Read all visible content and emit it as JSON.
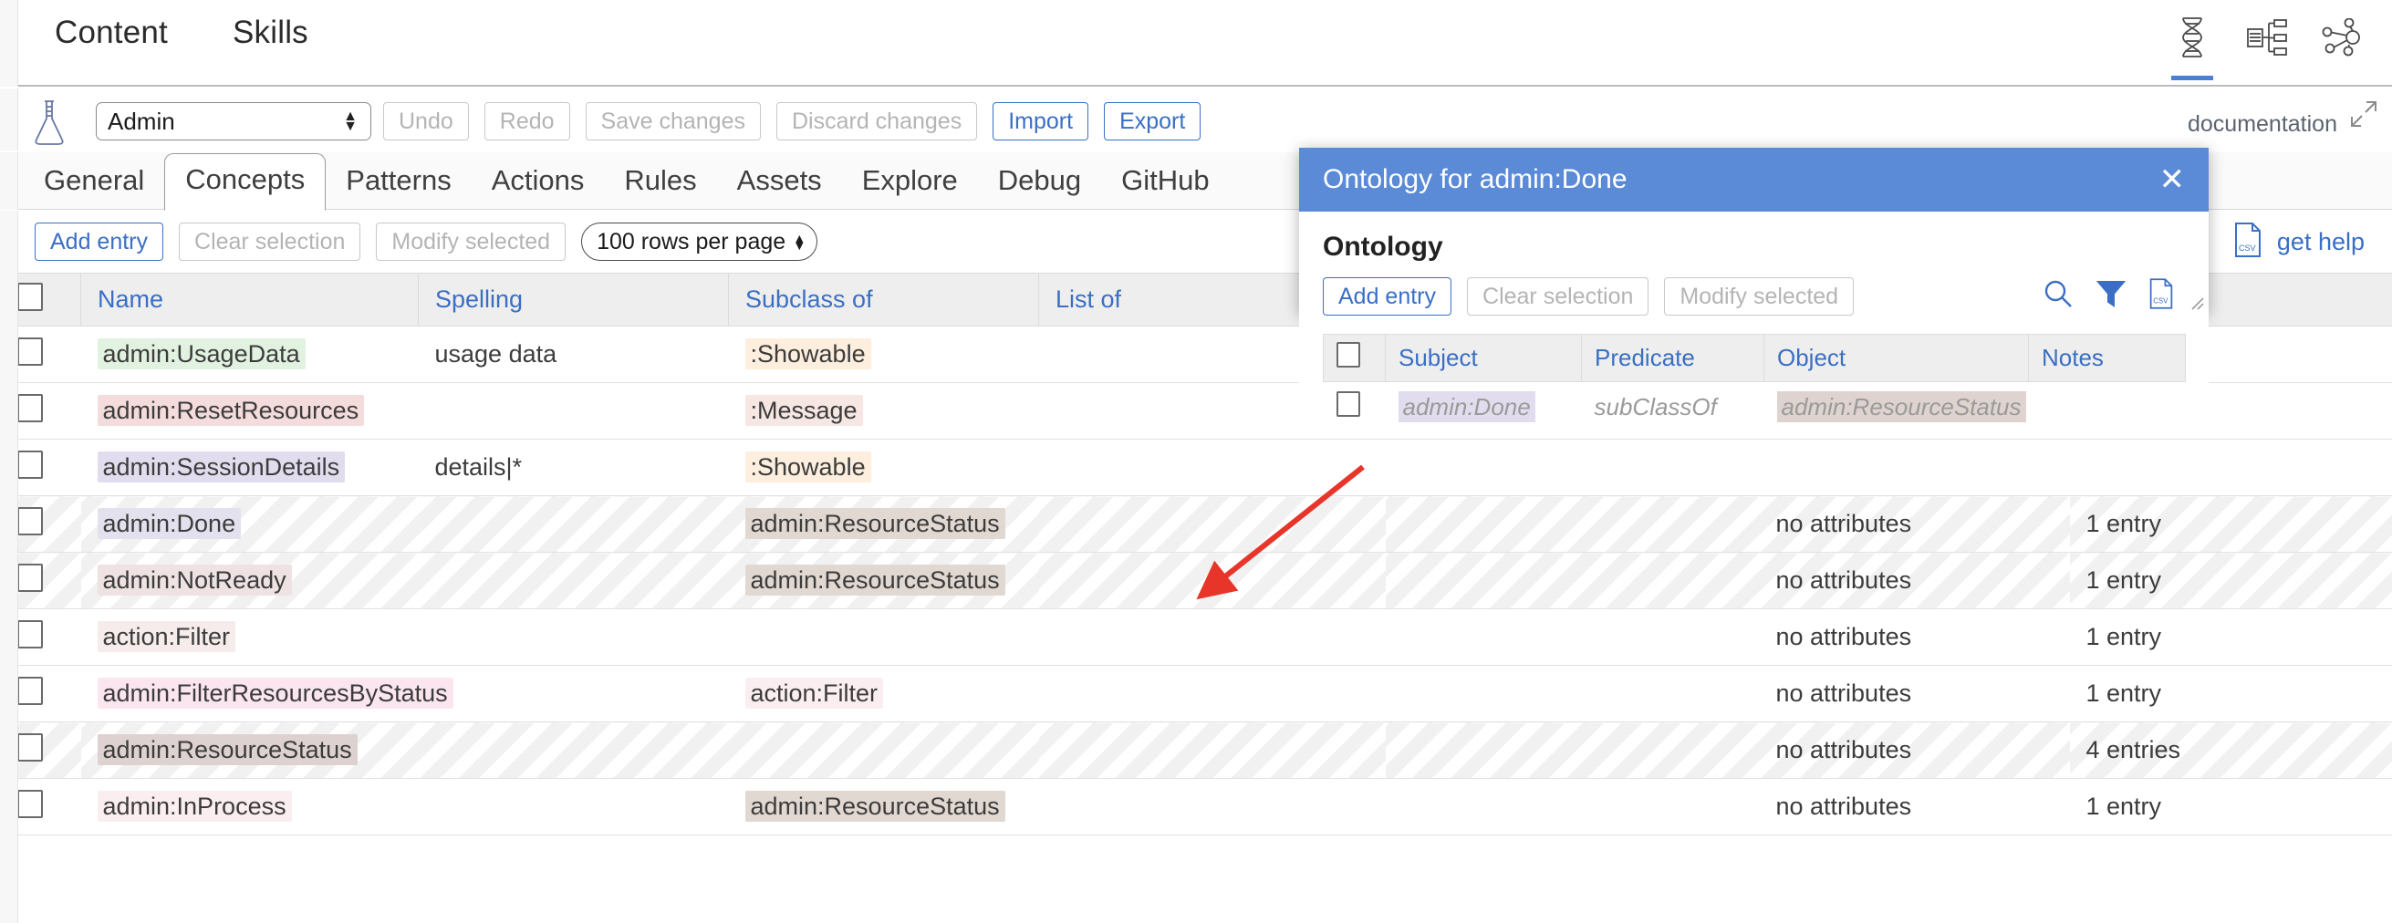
{
  "top_nav": {
    "items": [
      {
        "label": "Content"
      },
      {
        "label": "Skills"
      }
    ],
    "icons": [
      {
        "name": "dna-helix-icon",
        "active": true
      },
      {
        "name": "hierarchy-tree-icon",
        "active": false
      },
      {
        "name": "network-graph-icon",
        "active": false
      }
    ]
  },
  "action_bar": {
    "project_select": {
      "value": "Admin"
    },
    "buttons": [
      {
        "label": "Undo",
        "enabled": false
      },
      {
        "label": "Redo",
        "enabled": false
      },
      {
        "label": "Save changes",
        "enabled": false
      },
      {
        "label": "Discard changes",
        "enabled": false
      },
      {
        "label": "Import",
        "enabled": true
      },
      {
        "label": "Export",
        "enabled": true
      }
    ],
    "documentation_label": "documentation"
  },
  "tabs": [
    {
      "label": "General",
      "active": false
    },
    {
      "label": "Concepts",
      "active": true
    },
    {
      "label": "Patterns",
      "active": false
    },
    {
      "label": "Actions",
      "active": false
    },
    {
      "label": "Rules",
      "active": false
    },
    {
      "label": "Assets",
      "active": false
    },
    {
      "label": "Explore",
      "active": false
    },
    {
      "label": "Debug",
      "active": false
    },
    {
      "label": "GitHub",
      "active": false
    }
  ],
  "table_toolbar": {
    "add_entry_label": "Add entry",
    "clear_selection_label": "Clear selection",
    "modify_selected_label": "Modify selected",
    "rows_per_page_label": "100 rows per page",
    "get_help_label": "get help",
    "csv_icon_label": "CSV"
  },
  "main_table": {
    "headers": [
      "Name",
      "Spelling",
      "Subclass of",
      "List of",
      "",
      "",
      ""
    ],
    "rows": [
      {
        "name": "admin:UsageData",
        "name_hl": "hl-green",
        "spelling": "usage data",
        "subclass": ":Showable",
        "sub_hl": "hl-cream",
        "listof": "",
        "mid": "",
        "attributes": "",
        "entries": ""
      },
      {
        "name": "admin:ResetResources",
        "name_hl": "hl-pink",
        "spelling": "",
        "subclass": ":Message",
        "sub_hl": "hl-peach",
        "listof": "",
        "mid": "",
        "attributes": "",
        "entries": ""
      },
      {
        "name": "admin:SessionDetails",
        "name_hl": "hl-lav",
        "spelling": "details|*",
        "subclass": ":Showable",
        "sub_hl": "hl-cream",
        "listof": "",
        "mid": "",
        "attributes": "",
        "entries": ""
      },
      {
        "name": "admin:Done",
        "name_hl": "hl-lav2",
        "spelling": "",
        "subclass": "admin:ResourceStatus",
        "sub_hl": "hl-tan",
        "listof": "",
        "mid": "",
        "attributes": "no attributes",
        "entries": "1 entry",
        "striped": true
      },
      {
        "name": "admin:NotReady",
        "name_hl": "hl-rose",
        "spelling": "",
        "subclass": "admin:ResourceStatus",
        "sub_hl": "hl-tan",
        "listof": "",
        "mid": "",
        "attributes": "no attributes",
        "entries": "1 entry",
        "striped": true
      },
      {
        "name": "action:Filter",
        "name_hl": "hl-rose2",
        "spelling": "",
        "subclass": "",
        "sub_hl": "",
        "listof": "",
        "mid": "",
        "attributes": "no attributes",
        "entries": "1 entry"
      },
      {
        "name": "admin:FilterResourcesByStatus",
        "name_hl": "hl-pink2",
        "spelling": "",
        "subclass": "action:Filter",
        "sub_hl": "hl-blush",
        "listof": "",
        "mid": "",
        "attributes": "no attributes",
        "entries": "1 entry"
      },
      {
        "name": "admin:ResourceStatus",
        "name_hl": "hl-taupe",
        "spelling": "",
        "subclass": "",
        "sub_hl": "",
        "listof": "",
        "mid": "",
        "attributes": "no attributes",
        "entries": "4 entries",
        "striped": true
      },
      {
        "name": "admin:InProcess",
        "name_hl": "hl-blush",
        "spelling": "",
        "subclass": "admin:ResourceStatus",
        "sub_hl": "hl-tan",
        "listof": "",
        "mid": "",
        "attributes": "no attributes",
        "entries": "1 entry"
      }
    ]
  },
  "modal": {
    "title": "Ontology for admin:Done",
    "close_label": "✕",
    "section_title": "Ontology",
    "add_entry_label": "Add entry",
    "clear_selection_label": "Clear selection",
    "modify_selected_label": "Modify selected",
    "csv_icon_label": "CSV",
    "headers": [
      "Subject",
      "Predicate",
      "Object",
      "Notes"
    ],
    "rows": [
      {
        "subject": "admin:Done",
        "predicate": "subClassOf",
        "object": "admin:ResourceStatus",
        "notes": ""
      }
    ]
  },
  "colors": {
    "accent_blue": "#3a6fc4",
    "modal_header": "#5b8ad6",
    "arrow_red": "#e8352a",
    "header_bg": "#eeeeee"
  }
}
